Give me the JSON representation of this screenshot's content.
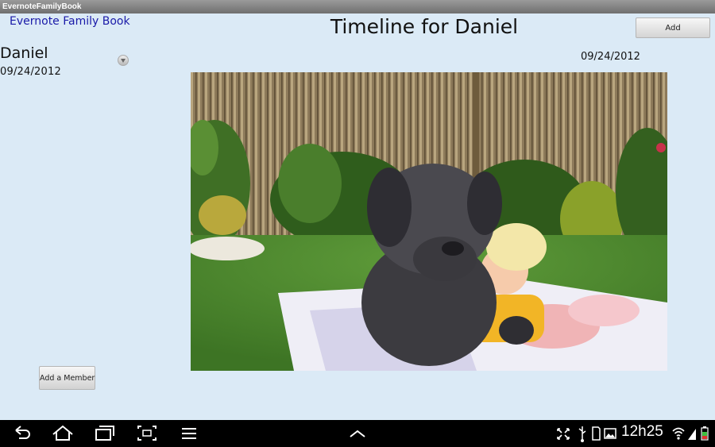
{
  "window": {
    "title": "EvernoteFamilyBook"
  },
  "header": {
    "app_link": "Evernote Family Book",
    "page_title": "Timeline for Daniel",
    "add_label": "Add"
  },
  "sidebar": {
    "member_name": "Daniel",
    "member_date": "09/24/2012",
    "add_member_label": "Add a Member"
  },
  "timeline": {
    "entries": [
      {
        "date": "09/24/2012",
        "photo": "baby-and-dog-on-lawn-photo"
      }
    ]
  },
  "status_bar": {
    "time": "12h25"
  },
  "colors": {
    "app_background": "#dbeaf6",
    "link": "#1a1aa8",
    "system_bar": "#000000"
  },
  "icons": {
    "nav": [
      "back-icon",
      "home-icon",
      "recent-apps-icon",
      "screenshot-icon",
      "menu-icon",
      "expand-up-icon"
    ],
    "status": [
      "fullscreen-icon",
      "usb-icon",
      "sd-card-icon",
      "gallery-icon",
      "wifi-icon",
      "signal-icon",
      "battery-icon"
    ]
  }
}
